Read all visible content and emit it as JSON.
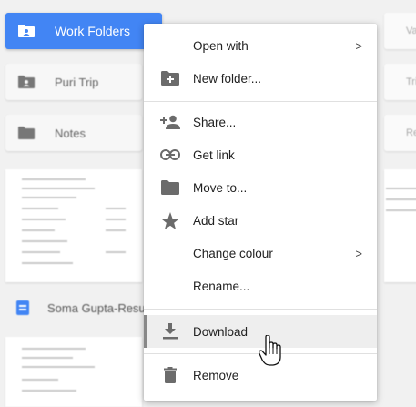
{
  "folders": [
    {
      "label": "Work Folders",
      "selected": true
    },
    {
      "label": "Puri Trip",
      "selected": false
    },
    {
      "label": "Notes",
      "selected": false
    }
  ],
  "recent_file": {
    "name": "Soma Gupta-Resu"
  },
  "right_cards": [
    "Vaca",
    "Tripl",
    "Rec"
  ],
  "menu": {
    "items": [
      {
        "label": "Open with",
        "icon": "none",
        "submenu": true
      },
      {
        "label": "New folder...",
        "icon": "new-folder-icon"
      },
      {
        "label": "Share...",
        "icon": "share-person-icon"
      },
      {
        "label": "Get link",
        "icon": "link-icon"
      },
      {
        "label": "Move to...",
        "icon": "folder-icon"
      },
      {
        "label": "Add star",
        "icon": "star-icon"
      },
      {
        "label": "Change colour",
        "icon": "none",
        "submenu": true
      },
      {
        "label": "Rename...",
        "icon": "none"
      },
      {
        "label": "Download",
        "icon": "download-icon",
        "hovered": true
      },
      {
        "label": "Remove",
        "icon": "trash-icon"
      }
    ],
    "chevron": ">"
  },
  "colors": {
    "accent": "#4285f4",
    "menu_icon": "#6b6b6b"
  }
}
